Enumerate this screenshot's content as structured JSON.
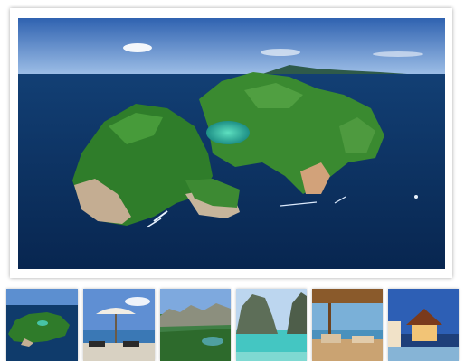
{
  "gallery": {
    "main_image": {
      "subject": "aerial-island-photo",
      "colors": {
        "sky_top": "#3d6fb8",
        "sky_bottom": "#8fb3e0",
        "sea": "#0b2f5e",
        "lagoon": "#37c3a6",
        "vegetation": "#2f7d2a",
        "cliff": "#c8b49a"
      }
    },
    "thumbnails": [
      {
        "subject": "island-aerial-thumbnail"
      },
      {
        "subject": "beach-umbrella-thumbnail"
      },
      {
        "subject": "limestone-hills-thumbnail"
      },
      {
        "subject": "lagoon-cliffs-thumbnail"
      },
      {
        "subject": "resort-terrace-thumbnail"
      },
      {
        "subject": "pavilion-night-thumbnail"
      }
    ]
  }
}
